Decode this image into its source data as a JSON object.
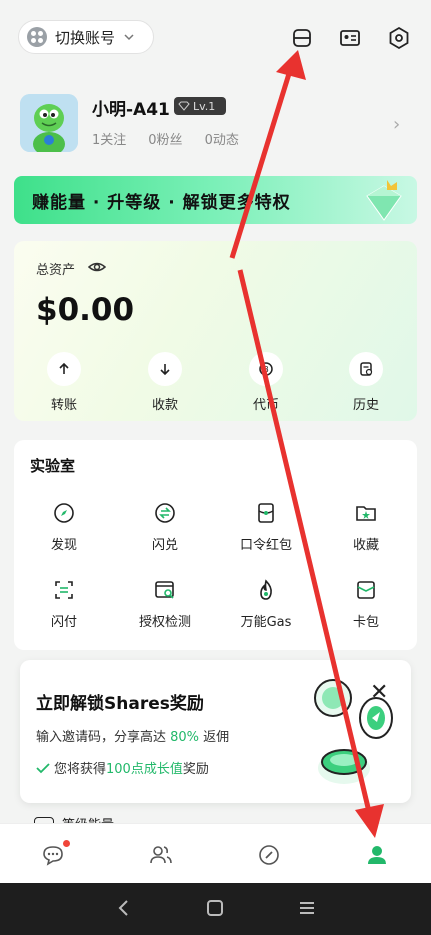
{
  "topbar": {
    "switch_label": "切换账号",
    "icons": [
      "scan-icon",
      "id-card-icon",
      "settings-icon"
    ]
  },
  "profile": {
    "name": "小明-A41",
    "level": "Lv.1",
    "following": "1关注",
    "fans": "0粉丝",
    "posts": "0动态"
  },
  "banner": {
    "text": "赚能量 · 升等级 · 解锁更多特权"
  },
  "assets": {
    "label": "总资产",
    "amount": "$0.00",
    "actions": [
      {
        "label": "转账",
        "icon": "arrow-up-icon"
      },
      {
        "label": "收款",
        "icon": "arrow-down-icon"
      },
      {
        "label": "代币",
        "icon": "token-icon"
      },
      {
        "label": "历史",
        "icon": "history-icon"
      }
    ]
  },
  "lab": {
    "title": "实验室",
    "items": [
      {
        "label": "发现",
        "icon": "compass-icon"
      },
      {
        "label": "闪兑",
        "icon": "swap-icon"
      },
      {
        "label": "口令红包",
        "icon": "red-packet-icon"
      },
      {
        "label": "收藏",
        "icon": "star-folder-icon"
      },
      {
        "label": "闪付",
        "icon": "flash-pay-icon"
      },
      {
        "label": "授权检测",
        "icon": "auth-check-icon"
      },
      {
        "label": "万能Gas",
        "icon": "gas-flame-icon"
      },
      {
        "label": "卡包",
        "icon": "card-wallet-icon"
      }
    ]
  },
  "promo": {
    "title": "立即解锁Shares奖励",
    "sub_prefix": "输入邀请码，分享高达 ",
    "sub_highlight": "80%",
    "sub_suffix": " 返佣",
    "check_prefix": "您将获得",
    "check_highlight": "100点成长值",
    "check_suffix": "奖励"
  },
  "partial_row": {
    "label": "等级能量"
  },
  "tabs": [
    {
      "name": "messages",
      "active": false,
      "badge": true
    },
    {
      "name": "contacts",
      "active": false
    },
    {
      "name": "discover",
      "active": false
    },
    {
      "name": "me",
      "active": true
    }
  ],
  "colors": {
    "accent": "#22b86a",
    "arrow": "#e8322f"
  }
}
